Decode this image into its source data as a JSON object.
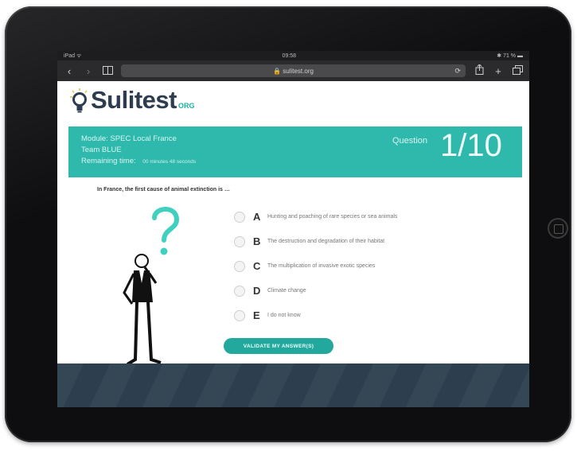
{
  "device": {
    "status_left": "iPad ᯤ",
    "status_time": "09:58",
    "status_right": "✱ 71 % ▬"
  },
  "browser": {
    "url": "🔒 sulitest.org",
    "back_icon": "chevron-left-icon",
    "forward_icon": "chevron-right-icon"
  },
  "brand": {
    "logo_text": "Sulitest",
    "logo_mark": "ORG",
    "accent": "#2fb8ac",
    "dark": "#2d3d4f"
  },
  "banner": {
    "module": "Module: SPEC Local France",
    "team": "Team BLUE",
    "remaining_label": "Remaining time:",
    "remaining_value": "00 minutes 48 seconds",
    "question_label": "Question",
    "question_number": "1/10"
  },
  "question": {
    "prompt": "In France, the first cause of animal extinction is …"
  },
  "answers": [
    {
      "letter": "A",
      "text": "Hunting and poaching of rare species or sea animals"
    },
    {
      "letter": "B",
      "text": "The destruction and degradation of their habitat"
    },
    {
      "letter": "C",
      "text": "The multiplication of invasive exotic species"
    },
    {
      "letter": "D",
      "text": "Climate change"
    },
    {
      "letter": "E",
      "text": "I do not know"
    }
  ],
  "actions": {
    "validate_label": "VALIDATE MY ANSWER(S)"
  }
}
